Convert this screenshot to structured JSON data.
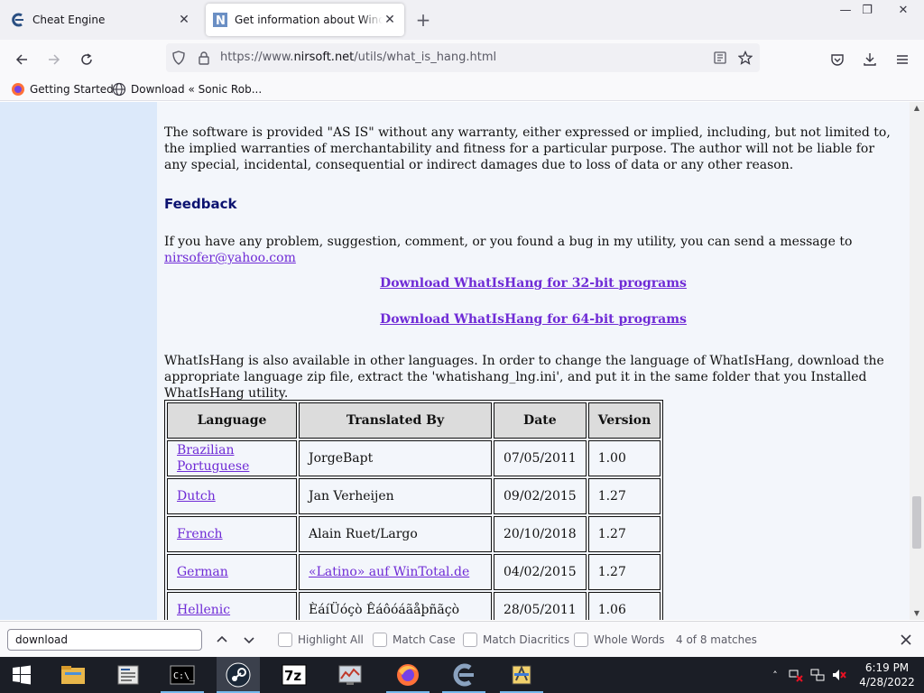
{
  "browser": {
    "tabs": [
      {
        "title": "Cheat Engine",
        "icon": "cheat-engine-icon"
      },
      {
        "title": "Get information about Windows hang",
        "icon": "nirsoft-icon"
      }
    ],
    "url_prefix": "https://www.",
    "url_domain": "nirsoft.net",
    "url_path": "/utils/what_is_hang.html",
    "bookmarks": [
      {
        "label": "Getting Started",
        "icon": "firefox-icon"
      },
      {
        "label": "Download « Sonic Rob...",
        "icon": "globe-icon"
      }
    ]
  },
  "page": {
    "disclaimer": "The software is provided \"AS IS\" without any warranty, either expressed or implied, including, but not limited to, the implied warranties of merchantability and fitness for a particular purpose. The author will not be liable for any special, incidental, consequential or indirect damages due to loss of data or any other reason.",
    "feedback_heading": "Feedback",
    "feedback_text": "If you have any problem, suggestion, comment, or you found a bug in my utility, you can send a message to ",
    "feedback_email": "nirsofer@yahoo.com",
    "download_32": "Download WhatIsHang for 32-bit programs",
    "download_64": "Download WhatIsHang for 64-bit programs",
    "languages_text": "WhatIsHang is also available in other languages. In order to change the language of WhatIsHang, download the appropriate language zip file, extract the 'whatishang_lng.ini', and put it in the same folder that you Installed WhatIsHang utility.",
    "table_headers": [
      "Language",
      "Translated By",
      "Date",
      "Version"
    ],
    "table_rows": [
      {
        "language": "Brazilian Portuguese",
        "translator": "JorgeBapt",
        "translator_link": false,
        "date": "07/05/2011",
        "version": "1.00"
      },
      {
        "language": "Dutch",
        "translator": "Jan Verheijen",
        "translator_link": false,
        "date": "09/02/2015",
        "version": "1.27"
      },
      {
        "language": "French",
        "translator": "Alain Ruet/Largo",
        "translator_link": false,
        "date": "20/10/2018",
        "version": "1.27"
      },
      {
        "language": "German",
        "translator": "«Latino» auf WinTotal.de",
        "translator_link": true,
        "date": "04/02/2015",
        "version": "1.27"
      },
      {
        "language": "Hellenic",
        "translator": "ÈáíÜóçò Êáôóáãåþñãçò",
        "translator_link": false,
        "date": "28/05/2011",
        "version": "1.06"
      }
    ]
  },
  "findbar": {
    "query": "download",
    "highlight_all": "Highlight All",
    "match_case": "Match Case",
    "match_diacritics": "Match Diacritics",
    "whole_words": "Whole Words",
    "matches": "4 of 8 matches"
  },
  "taskbar": {
    "apps": [
      "windows-start-icon",
      "file-explorer-icon",
      "server-manager-icon",
      "command-prompt-icon",
      "steam-icon",
      "7zip-icon",
      "performance-monitor-icon",
      "firefox-icon",
      "cheat-engine-icon",
      "app-icon"
    ],
    "time": "6:19 PM",
    "date": "4/28/2022"
  },
  "colors": {
    "link": "#6f2bd6",
    "heading": "#0b1270",
    "left_pane": "#dce9fa",
    "content_bg": "#f3f6fb",
    "taskbar": "#1b1e26"
  }
}
